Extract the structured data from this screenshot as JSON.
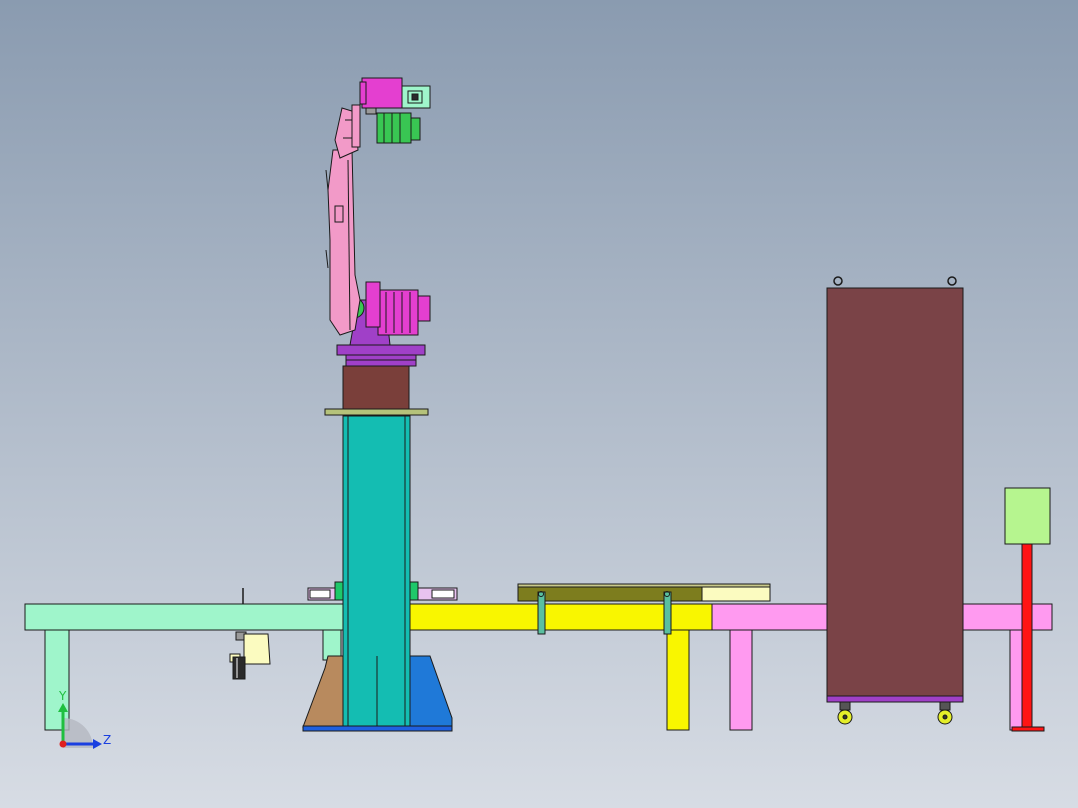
{
  "view": {
    "background_top": "#8a9bb0",
    "background_bottom": "#d7dce4"
  },
  "triad": {
    "y_label": "Y",
    "z_label": "Z",
    "y_color": "#1fbf3f",
    "z_color": "#1a3fe0",
    "origin_color": "#e02020"
  },
  "colors": {
    "robot_arm": "#f29ac8",
    "robot_joint": "#e43fd0",
    "robot_base": "#a040c8",
    "motor": "#39c653",
    "pedestal": "#14bdb2",
    "pedestal_riser": "#7a3f3a",
    "left_gusset": "#b88a5e",
    "right_gusset": "#1f79d8",
    "left_table": "#9ff5cb",
    "mid_table": "#f9f600",
    "right_table": "#ff9af0",
    "tray": "#7d7d1e",
    "tray_end": "#fbfbc0",
    "cabinet": "#7a4347",
    "cabinet_base": "#a040c8",
    "wheel": "#e4ee2a",
    "signal_box": "#b6f58f",
    "signal_pole": "#ff1414",
    "outline": "#1a1a1a"
  }
}
